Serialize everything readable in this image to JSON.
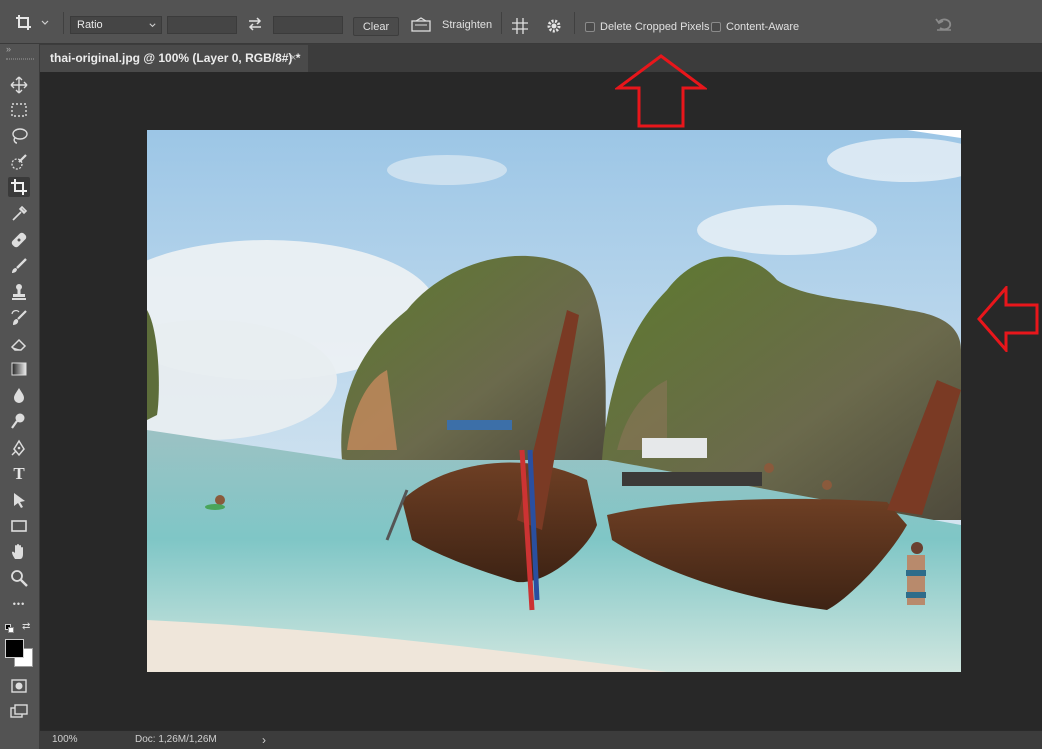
{
  "options_bar": {
    "ratio_value": "Ratio",
    "width_value": "",
    "height_value": "",
    "clear_label": "Clear",
    "straighten_label": "Straighten",
    "delete_cropped_label": "Delete Cropped Pixels",
    "delete_cropped_checked": false,
    "content_aware_label": "Content-Aware",
    "content_aware_checked": false
  },
  "document": {
    "tab_title": "thai-original.jpg @ 100% (Layer 0, RGB/8#) *",
    "close_glyph": "×"
  },
  "toolbar": {
    "tools": [
      {
        "name": "move-icon"
      },
      {
        "name": "marquee-icon"
      },
      {
        "name": "lasso-icon"
      },
      {
        "name": "quick-select-icon"
      },
      {
        "name": "crop-icon",
        "active": true
      },
      {
        "name": "eyedropper-icon"
      },
      {
        "name": "healing-brush-icon"
      },
      {
        "name": "brush-icon"
      },
      {
        "name": "clone-stamp-icon"
      },
      {
        "name": "history-brush-icon"
      },
      {
        "name": "eraser-icon"
      },
      {
        "name": "gradient-icon"
      },
      {
        "name": "blur-icon"
      },
      {
        "name": "dodge-icon"
      },
      {
        "name": "pen-icon"
      },
      {
        "name": "type-icon"
      },
      {
        "name": "path-select-icon"
      },
      {
        "name": "rectangle-icon"
      },
      {
        "name": "hand-icon"
      },
      {
        "name": "zoom-icon"
      },
      {
        "name": "more-tools-icon"
      }
    ],
    "type_glyph": "T",
    "more_glyph": "•••",
    "foreground_color": "#000000",
    "background_color": "#ffffff"
  },
  "status_bar": {
    "zoom": "100%",
    "doc_info": "Doc: 1,26M/1,26M",
    "arrow": "›"
  },
  "annotations": {
    "arrow_color": "#e8161b"
  }
}
